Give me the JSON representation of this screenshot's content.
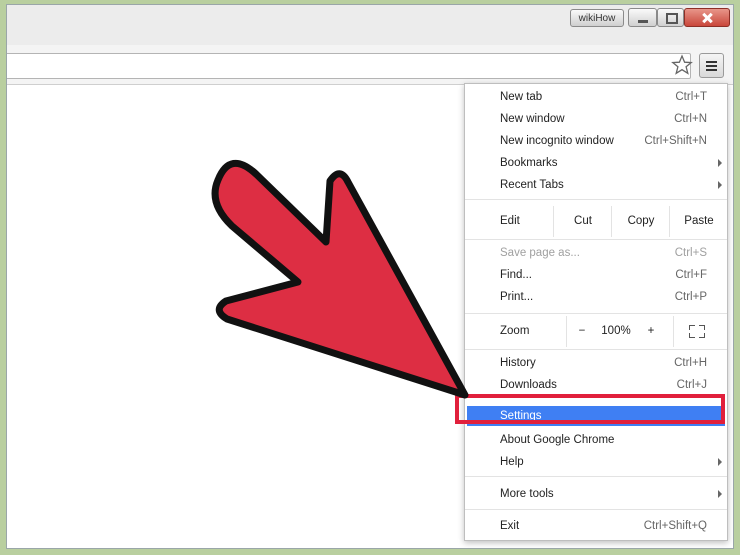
{
  "window": {
    "badge": "wikiHow",
    "controls": [
      "minimize-icon",
      "maximize-icon",
      "close-icon"
    ]
  },
  "toolbar": {
    "bookmark_icon": "star-icon",
    "menu_icon": "hamburger-menu-icon"
  },
  "menu": {
    "new_tab": {
      "label": "New tab",
      "shortcut": "Ctrl+T"
    },
    "new_window": {
      "label": "New window",
      "shortcut": "Ctrl+N"
    },
    "new_incognito": {
      "label": "New incognito window",
      "shortcut": "Ctrl+Shift+N"
    },
    "bookmarks": {
      "label": "Bookmarks"
    },
    "recent_tabs": {
      "label": "Recent Tabs"
    },
    "edit": {
      "label": "Edit",
      "cut": "Cut",
      "copy": "Copy",
      "paste": "Paste"
    },
    "save_page": {
      "label": "Save page as...",
      "shortcut": "Ctrl+S"
    },
    "find": {
      "label": "Find...",
      "shortcut": "Ctrl+F"
    },
    "print": {
      "label": "Print...",
      "shortcut": "Ctrl+P"
    },
    "zoom": {
      "label": "Zoom",
      "minus": "−",
      "level": "100%",
      "plus": "+"
    },
    "history": {
      "label": "History",
      "shortcut": "Ctrl+H"
    },
    "downloads": {
      "label": "Downloads",
      "shortcut": "Ctrl+J"
    },
    "settings": {
      "label": "Settings"
    },
    "about": {
      "label": "About Google Chrome"
    },
    "help": {
      "label": "Help"
    },
    "more_tools": {
      "label": "More tools"
    },
    "exit": {
      "label": "Exit",
      "shortcut": "Ctrl+Shift+Q"
    }
  },
  "colors": {
    "highlight": "#3f7ff3",
    "annotation_red": "#e1203c",
    "frame_green": "#b9cf9f"
  }
}
